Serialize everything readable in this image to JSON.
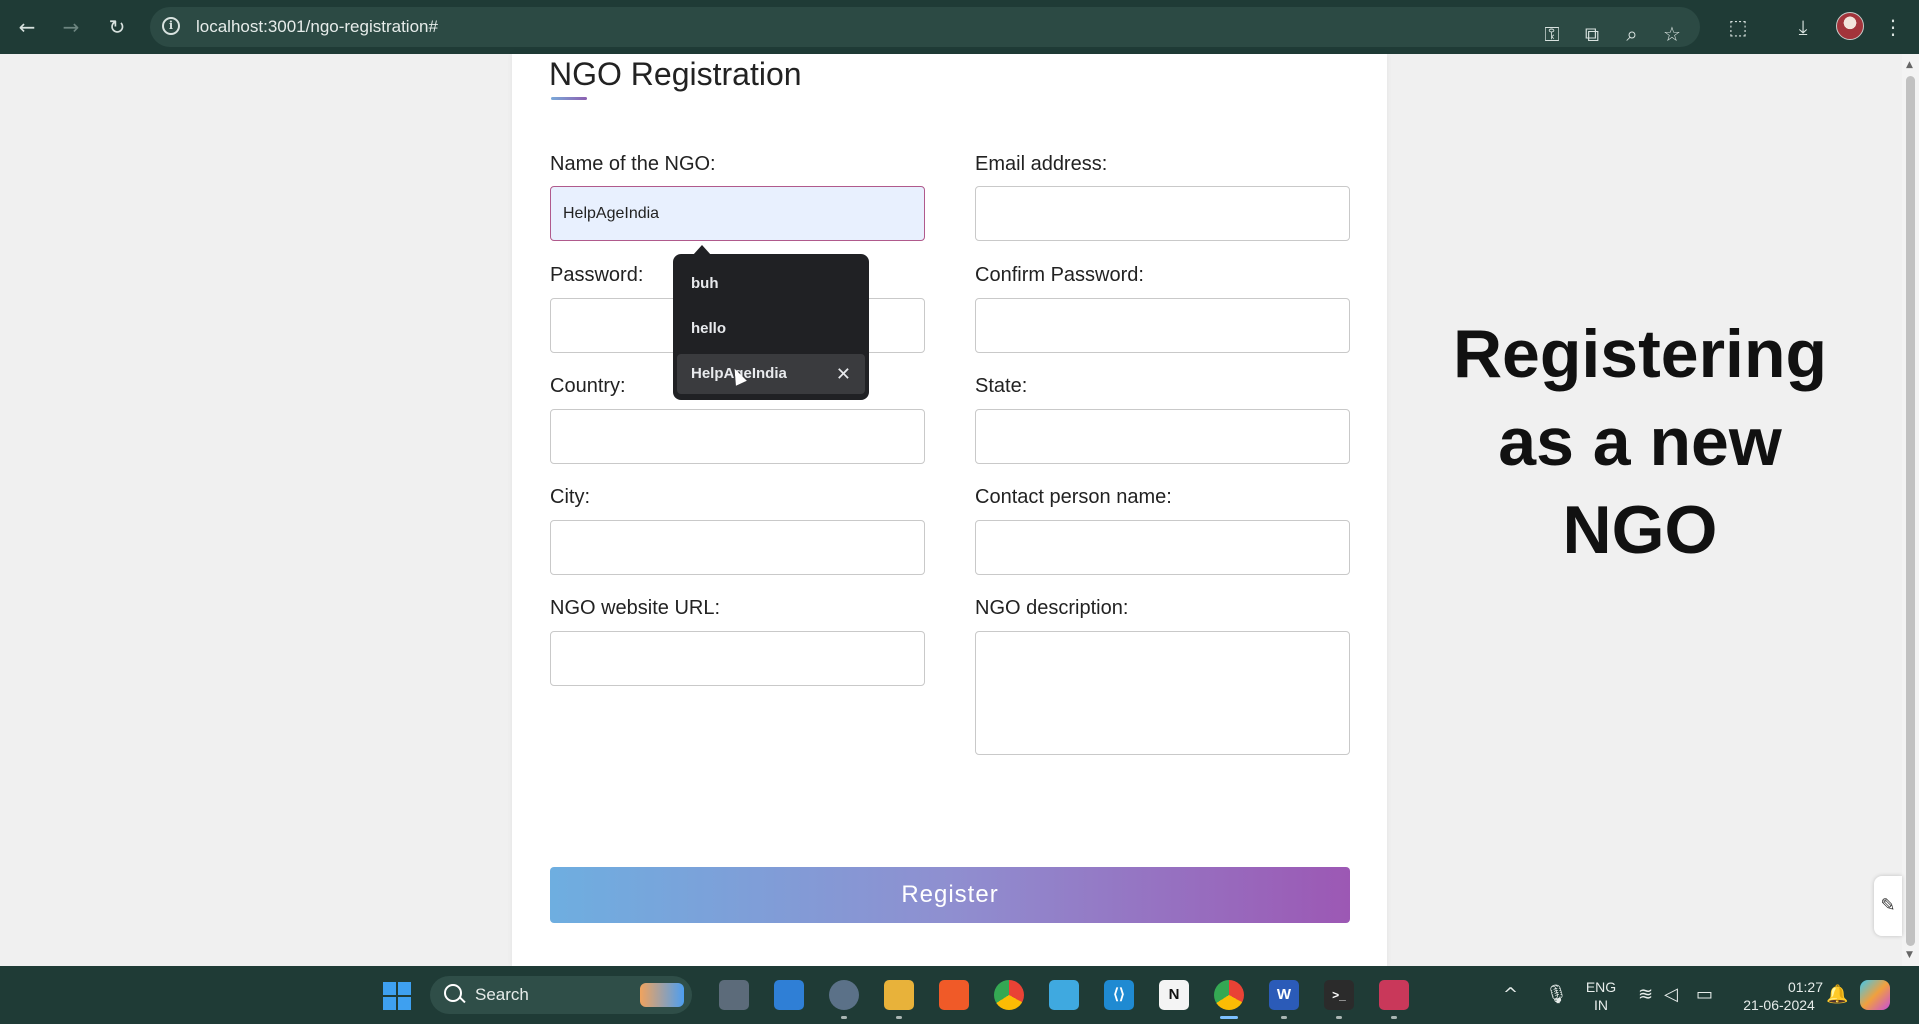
{
  "browser": {
    "url": "localhost:3001/ngo-registration#",
    "back": "←",
    "forward": "→",
    "reload": "↻",
    "info": "i",
    "icons": [
      "key-icon",
      "cast-icon",
      "zoom-icon",
      "star-icon",
      "extensions-icon",
      "download-icon",
      "avatar",
      "menu-icon"
    ]
  },
  "form": {
    "title": "NGO Registration",
    "fields": {
      "ngo_name": {
        "label": "Name of the NGO:",
        "value": "HelpAgeIndia"
      },
      "email": {
        "label": "Email address:",
        "value": ""
      },
      "password": {
        "label": "Password:",
        "value": ""
      },
      "confirm_password": {
        "label": "Confirm Password:",
        "value": ""
      },
      "country": {
        "label": "Country:",
        "value": ""
      },
      "state": {
        "label": "State:",
        "value": ""
      },
      "city": {
        "label": "City:",
        "value": ""
      },
      "contact_person": {
        "label": "Contact person name:",
        "value": ""
      },
      "website": {
        "label": "NGO website URL:",
        "value": ""
      },
      "description": {
        "label": "NGO description:",
        "value": ""
      }
    },
    "register_label": "Register"
  },
  "autofill": {
    "items": [
      {
        "label": "buh"
      },
      {
        "label": "hello"
      },
      {
        "label": "HelpAgeIndia",
        "remove": "✕"
      }
    ]
  },
  "side_heading": {
    "line1": "Registering",
    "line2": "as a new",
    "line3": "NGO"
  },
  "taskbar": {
    "search_label": "Search",
    "lang": "ENG",
    "region": "IN",
    "time": "01:27",
    "date": "21-06-2024",
    "apps": [
      "task-view",
      "store",
      "settings",
      "file-explorer",
      "brave",
      "chrome",
      "notepad",
      "vscode",
      "notion",
      "chrome-active",
      "word",
      "terminal",
      "snipping-tool"
    ],
    "app_glyphs": {
      "vscode": "⟨⟩",
      "notion": "N",
      "word": "W",
      "terminal": ">_"
    }
  },
  "colors": {
    "chrome_bg": "#1f3b36",
    "focus_border": "#b05a8c",
    "button_gradient_start": "#6eaee0",
    "button_gradient_end": "#9c58b4"
  }
}
